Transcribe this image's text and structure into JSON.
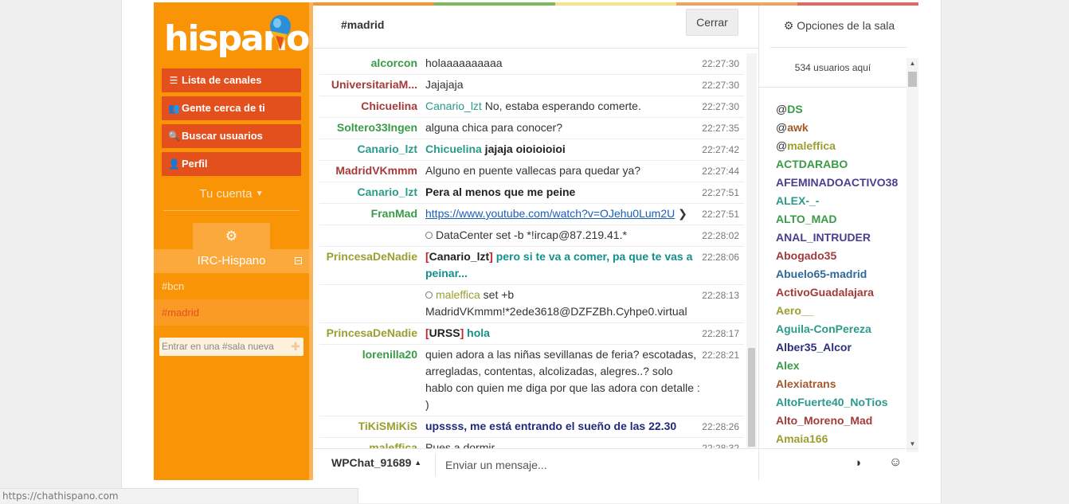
{
  "sidebar": {
    "logo_text": "hispano",
    "menu": [
      {
        "label": "Lista de canales",
        "icon": "list-icon"
      },
      {
        "label": "Gente cerca de ti",
        "icon": "users-icon"
      },
      {
        "label": "Buscar usuarios",
        "icon": "search-icon"
      },
      {
        "label": "Perfil",
        "icon": "user-icon"
      }
    ],
    "account_label": "Tu cuenta",
    "network_name": "IRC-Hispano",
    "channels": [
      "#bcn",
      "#madrid"
    ],
    "join_placeholder": "Entrar en una #sala nueva"
  },
  "topbar_colors": [
    "#f7942f",
    "#7cb85c",
    "#f3e58a",
    "#f4a25e",
    "#e4665c"
  ],
  "channel": {
    "name": "#madrid",
    "close_label": "Cerrar"
  },
  "messages": [
    {
      "nick": "alcorcon",
      "color": "#3a9b46",
      "parts": [
        {
          "t": "holaaaaaaaaaa"
        }
      ],
      "time": "22:27:30"
    },
    {
      "nick": "UniversitariaM...",
      "color": "#a33b3b",
      "parts": [
        {
          "t": "Jajajaja"
        }
      ],
      "time": "22:27:30"
    },
    {
      "nick": "Chicuelina",
      "color": "#a33b3b",
      "parts": [
        {
          "t": "Canario_lzt",
          "c": "#2a9a8a"
        },
        {
          "t": " No, estaba esperando comerte."
        }
      ],
      "time": "22:27:30"
    },
    {
      "nick": "Soltero33Ingen",
      "color": "#3a9b46",
      "parts": [
        {
          "t": "alguna chica para conocer?"
        }
      ],
      "time": "22:27:35"
    },
    {
      "nick": "Canario_lzt",
      "color": "#2a9a8a",
      "parts": [
        {
          "t": "Chicuelina",
          "c": "#2a9a8a",
          "b": true
        },
        {
          "t": " jajaja oioioioioi",
          "b": true,
          "c": "#222"
        }
      ],
      "time": "22:27:42"
    },
    {
      "nick": "MadridVKmmm",
      "color": "#a33b3b",
      "parts": [
        {
          "t": "Alguno en puente vallecas para quedar ya?"
        }
      ],
      "time": "22:27:44"
    },
    {
      "nick": "Canario_lzt",
      "color": "#2a9a8a",
      "parts": [
        {
          "t": "Pera al menos que me peine",
          "b": true,
          "c": "#222"
        }
      ],
      "time": "22:27:51"
    },
    {
      "nick": "FranMad",
      "color": "#3a9b46",
      "link": "https://www.youtube.com/watch?v=OJehu0Lum2U",
      "time": "22:27:51"
    },
    {
      "nick": "",
      "color": "#333",
      "system": true,
      "parts": [
        {
          "t": "DataCenter set -b *!ircap@87.219.41.*"
        }
      ],
      "time": "22:28:02"
    },
    {
      "nick": "PrincesaDeNadie",
      "color": "#9aa030",
      "parts": [
        {
          "t": "[",
          "c": "#c0262c",
          "b": true
        },
        {
          "t": "Canario_lzt",
          "c": "#222",
          "b": true
        },
        {
          "t": "]",
          "c": "#c0262c",
          "b": true
        },
        {
          "t": " pero si te va a comer, pa que te vas a peinar...",
          "c": "#13908a",
          "b": true
        }
      ],
      "time": "22:28:06"
    },
    {
      "nick": "",
      "color": "#333",
      "system": true,
      "parts": [
        {
          "t": "maleffica",
          "c": "#9aa030"
        },
        {
          "t": " set +b MadridVKmmm!*2ede3618@DZFZBh.Cyhpe0.virtual"
        }
      ],
      "time": "22:28:13"
    },
    {
      "nick": "PrincesaDeNadie",
      "color": "#9aa030",
      "parts": [
        {
          "t": "[",
          "c": "#c0262c",
          "b": true
        },
        {
          "t": "URSS",
          "c": "#222",
          "b": true
        },
        {
          "t": "]",
          "c": "#c0262c",
          "b": true
        },
        {
          "t": " hola",
          "c": "#13908a",
          "b": true
        }
      ],
      "time": "22:28:17"
    },
    {
      "nick": "lorenilla20",
      "color": "#3a9b46",
      "parts": [
        {
          "t": "quien adora a las niñas sevillanas de feria? escotadas, arregladas, contentas, alcolizadas, alegres..? solo hablo con quien me diga por que las adora con detalle : )"
        }
      ],
      "time": "22:28:21"
    },
    {
      "nick": "TiKiSMiKiS",
      "color": "#9aa030",
      "parts": [
        {
          "t": "upssss, me está entrando el sueño de las 22.30",
          "c": "#1f2a7a",
          "b": true
        }
      ],
      "time": "22:28:26"
    },
    {
      "nick": "maleffica",
      "color": "#9aa030",
      "parts": [
        {
          "t": "Pues a dormir"
        }
      ],
      "time": "22:28:32"
    }
  ],
  "right_panel": {
    "options_label": "Opciones de la sala",
    "users_count": "534 usuarios aquí",
    "users": [
      {
        "mode": "@",
        "name": "DS",
        "color": "#3a9b46"
      },
      {
        "mode": "@",
        "name": "awk",
        "color": "#a35a2a"
      },
      {
        "mode": "@",
        "name": "maleffica",
        "color": "#9aa030"
      },
      {
        "mode": "",
        "name": "ACTDARABO",
        "color": "#3a9b46"
      },
      {
        "mode": "",
        "name": "AFEMINADOACTIVO38",
        "color": "#4a3f8f"
      },
      {
        "mode": "",
        "name": "ALEX-_-",
        "color": "#2a9a8a"
      },
      {
        "mode": "",
        "name": "ALTO_MAD",
        "color": "#3a9b46"
      },
      {
        "mode": "",
        "name": "ANAL_INTRUDER",
        "color": "#4a3f8f"
      },
      {
        "mode": "",
        "name": "Abogado35",
        "color": "#a33b3b"
      },
      {
        "mode": "",
        "name": "Abuelo65-madrid",
        "color": "#2f6a9a"
      },
      {
        "mode": "",
        "name": "ActivoGuadalajara",
        "color": "#a33b3b"
      },
      {
        "mode": "",
        "name": "Aero__",
        "color": "#9aa030"
      },
      {
        "mode": "",
        "name": "Aguila-ConPereza",
        "color": "#2a9a8a"
      },
      {
        "mode": "",
        "name": "Alber35_Alcor",
        "color": "#2d2f7a"
      },
      {
        "mode": "",
        "name": "Alex",
        "color": "#3a9b46"
      },
      {
        "mode": "",
        "name": "Alexiatrans",
        "color": "#a35a2a"
      },
      {
        "mode": "",
        "name": "AltoFuerte40_NoTios",
        "color": "#2a9a8a"
      },
      {
        "mode": "",
        "name": "Alto_Moreno_Mad",
        "color": "#a33b3b"
      },
      {
        "mode": "",
        "name": "Amaia166",
        "color": "#9aa030"
      }
    ]
  },
  "input": {
    "nick": "WPChat_91689",
    "placeholder": "Enviar un mensaje..."
  },
  "statusbar": {
    "url": "https://chathispano.com"
  }
}
